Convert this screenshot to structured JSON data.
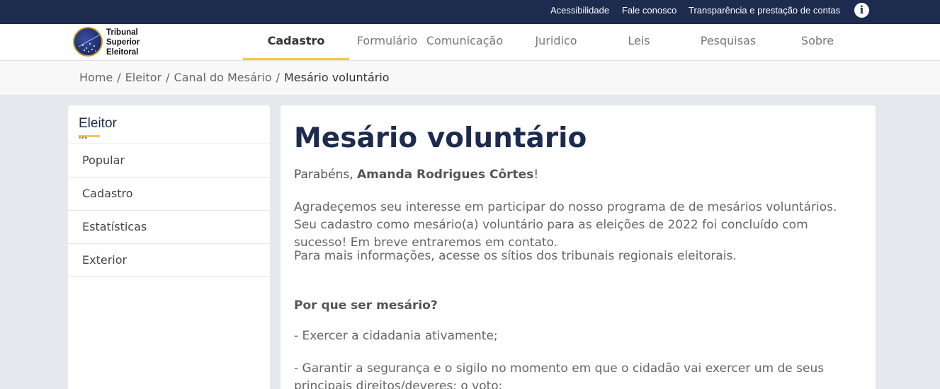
{
  "topbar": {
    "links": [
      "Acessibilidade",
      "Fale conosco",
      "Transparência e prestação de contas"
    ],
    "info_icon": "info-icon"
  },
  "logo": {
    "line1": "Tribunal",
    "line2": "Superior",
    "line3": "Eleitoral"
  },
  "nav": {
    "items": [
      "Cadastro",
      "Formulário",
      "Comunicação",
      "Juridico",
      "Leis",
      "Pesquisas",
      "Sobre"
    ],
    "active": "Cadastro"
  },
  "breadcrumb": {
    "items": [
      "Home",
      "Eleitor",
      "Canal do Mesário"
    ],
    "current": "Mesário voluntário",
    "separator": "/"
  },
  "sidebar": {
    "title": "Eleitor",
    "mark": "\"\"\"",
    "items": [
      "Popular",
      "Cadastro",
      "Estatísticas",
      "Exterior"
    ]
  },
  "main": {
    "title": "Mesário voluntário",
    "congrats_prefix": "Parabéns, ",
    "congrats_name": "Amanda Rodrigues Côrtes",
    "congrats_suffix": "!",
    "paragraph1": "Agradeçemos seu interesse em participar do nosso programa de de mesários voluntários. Seu cadastro como mesário(a) voluntário para as eleições de 2022 foi concluído com sucesso! Em breve entraremos em contato.",
    "paragraph2": "Para mais informações, acesse os sítios dos tribunais regionais eleitorais.",
    "why_heading": "Por que ser mesário?",
    "bullet1": "- Exercer a cidadania ativamente;",
    "bullet2": "- Garantir a segurança e o sigilo no momento em que o cidadão vai exercer um de seus principais direitos/deveres: o voto;"
  },
  "colors": {
    "navy": "#1d2b4f",
    "accent_yellow": "#f2c94c",
    "page_bg": "#e5e9ee"
  }
}
